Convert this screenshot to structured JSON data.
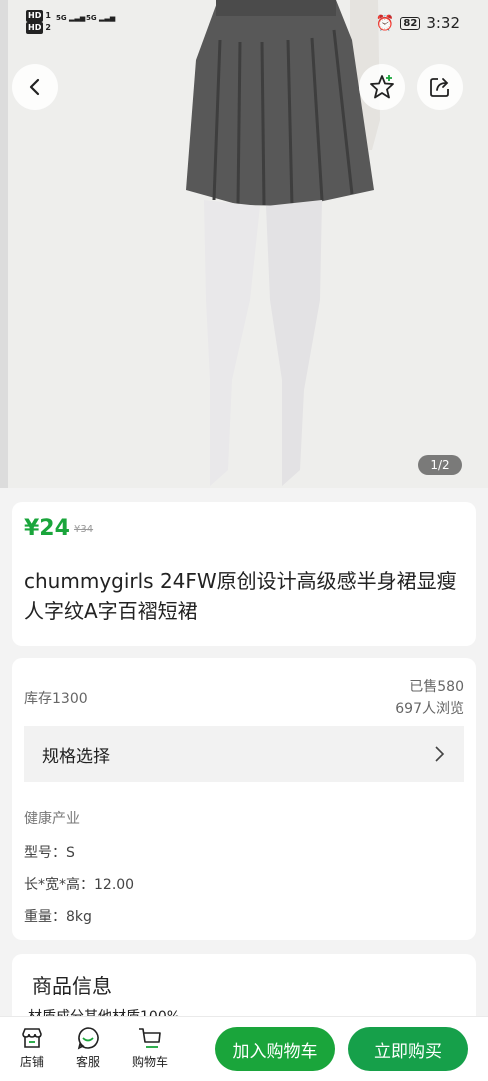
{
  "status_bar": {
    "left_line1": "HD",
    "left_line2": "HD",
    "signal1": "5G",
    "signal2": "5G",
    "battery": "82",
    "time": "3:32"
  },
  "hero": {
    "pager": "1/2"
  },
  "price_card": {
    "price": "¥24",
    "original_price": "¥34",
    "title": "chummygirls 24FW原创设计高级感半身裙显瘦人字纹A字百褶短裙"
  },
  "info_card": {
    "stock": "库存1300",
    "sold": "已售580",
    "views": "697人浏览",
    "spec_select": "规格选择",
    "category": "健康产业",
    "model": "型号：S",
    "dimensions": "长*宽*高：12.00",
    "weight": "重量：8kg"
  },
  "product_info": {
    "heading": "商品信息",
    "material_partial": "材质成分其他材质100%"
  },
  "bottom_bar": {
    "store": "店铺",
    "service": "客服",
    "cart": "购物车",
    "add_to_cart": "加入购物车",
    "buy_now": "立即购买"
  },
  "colors": {
    "accent": "#1aa53b",
    "button_green": "#1aa53b"
  },
  "icons": [
    "back-icon",
    "favorite-star-icon",
    "share-icon",
    "store-icon",
    "service-icon",
    "cart-icon"
  ]
}
